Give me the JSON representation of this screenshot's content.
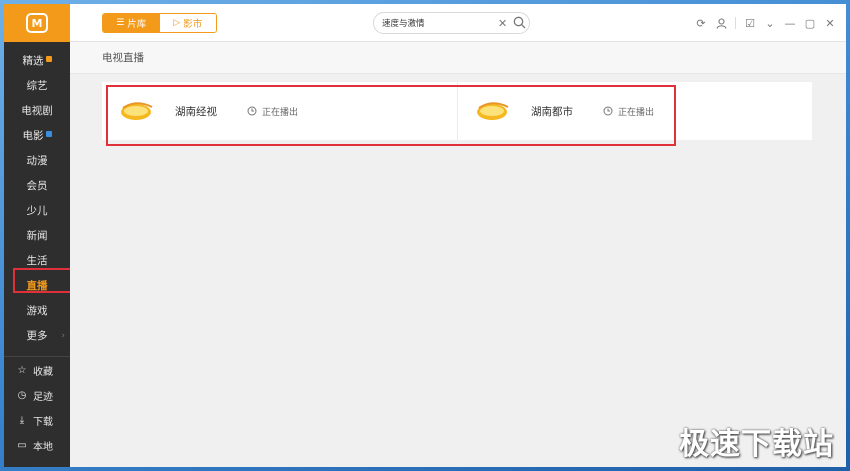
{
  "app": {
    "logo_text": "M"
  },
  "sidebar": {
    "items": [
      {
        "label": "精选",
        "badge": "orange"
      },
      {
        "label": "综艺"
      },
      {
        "label": "电视剧"
      },
      {
        "label": "电影",
        "badge": "blue"
      },
      {
        "label": "动漫"
      },
      {
        "label": "会员"
      },
      {
        "label": "少儿"
      },
      {
        "label": "新闻"
      },
      {
        "label": "生活"
      },
      {
        "label": "直播",
        "active": true
      },
      {
        "label": "游戏"
      },
      {
        "label": "更多",
        "chevron": true
      }
    ],
    "bottom": [
      {
        "label": "收藏",
        "icon": "star-icon"
      },
      {
        "label": "足迹",
        "icon": "clock-icon"
      },
      {
        "label": "下载",
        "icon": "download-icon"
      },
      {
        "label": "本地",
        "icon": "folder-icon"
      }
    ]
  },
  "topbar": {
    "tab_library": "片库",
    "tab_theater": "影市",
    "search_value": "速度与激情"
  },
  "content": {
    "section_title": "电视直播",
    "channels": [
      {
        "name": "湖南经视",
        "status": "正在播出"
      },
      {
        "name": "湖南都市",
        "status": "正在播出"
      }
    ]
  },
  "watermark": "极速下载站",
  "colors": {
    "accent": "#f39a1a",
    "sidebar_bg": "#2e2e2e",
    "highlight": "#e0303a"
  }
}
